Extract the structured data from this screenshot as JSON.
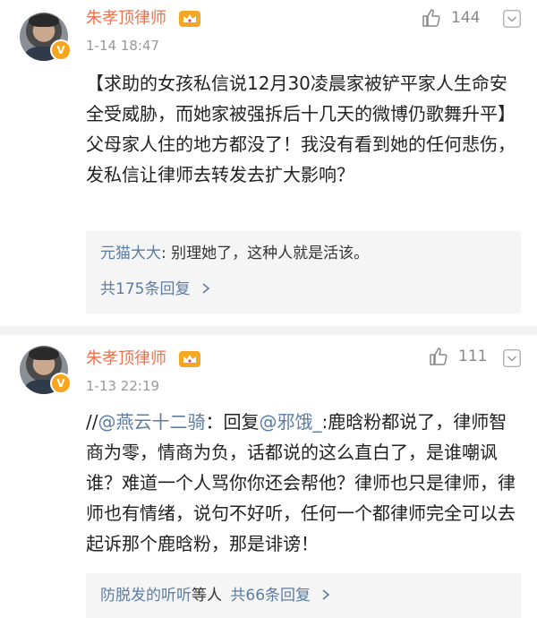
{
  "comments": [
    {
      "username": "朱孝顶律师",
      "timestamp": "1-14 18:47",
      "likes": "144",
      "body_segments": [
        {
          "text": "【求助的女孩私信说12月30凌晨家被铲平家人生命安全受威胁，而她家被强拆后十几天的微博仍歌舞升平】父母家人住的地方都没了！我没有看到她的任何悲伤，发私信让律师去转发去扩大影响？",
          "mention": false
        }
      ],
      "reply_preview": {
        "user": "元猫大大",
        "text": ": 别理她了，这种人就是活该。"
      },
      "reply_link": "共175条回复"
    },
    {
      "username": "朱孝顶律师",
      "timestamp": "1-13 22:19",
      "likes": "111",
      "body_segments": [
        {
          "text": "//",
          "mention": false
        },
        {
          "text": "@燕云十二骑",
          "mention": true
        },
        {
          "text": "：回复",
          "mention": false
        },
        {
          "text": "@邪饿_",
          "mention": true
        },
        {
          "text": ":鹿晗粉都说了，律师智商为零，情商为负，话都说的这么直白了，是谁嘲讽谁？难道一个人骂你你还会帮他？律师也只是律师，律师也有情绪，说句不好听，任何一个都律师完全可以去起诉那个鹿晗粉，那是诽谤！",
          "mention": false
        }
      ],
      "reply_users": "防脱发的听听",
      "reply_suffix": "等人",
      "reply_link": "共66条回复"
    }
  ],
  "icons": {
    "avatar_badge": "V",
    "like": "thumbs-up-icon",
    "more": "chevron-down-icon",
    "crown": "crown-badge-icon",
    "reply_arrow": "chevron-right-icon"
  },
  "colors": {
    "username": "#eb7350",
    "link": "#5b7da4",
    "meta": "#999999",
    "badge": "#f7a51e"
  }
}
